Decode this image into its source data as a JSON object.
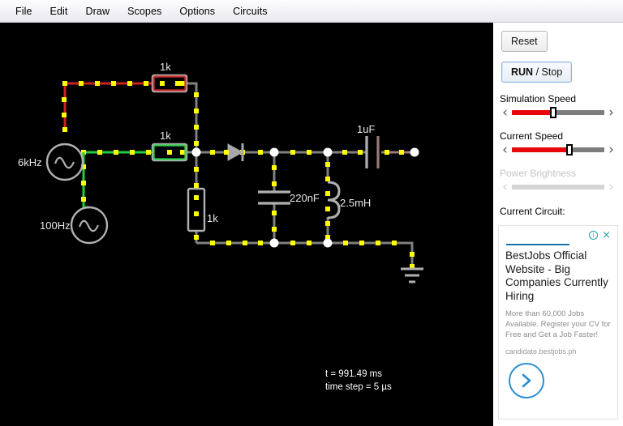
{
  "menubar": {
    "items": [
      {
        "label": "File"
      },
      {
        "label": "Edit"
      },
      {
        "label": "Draw"
      },
      {
        "label": "Scopes"
      },
      {
        "label": "Options"
      },
      {
        "label": "Circuits"
      }
    ]
  },
  "canvas": {
    "background_color": "#000000",
    "wire_color": "#808080",
    "charge_color": "#ffff00",
    "labels": {
      "source1": "6kHz",
      "source2": "100Hz",
      "r_top": "1k",
      "r_mid": "1k",
      "r_vert": "1k",
      "cap1": "220nF",
      "inductor": "2.5mH",
      "cap2": "1uF"
    },
    "status": {
      "time": "t = 991.49 ms",
      "timestep": "time step = 5 µs"
    },
    "voltage_colors": {
      "positive": "#cc2222",
      "negative": "#22cc44",
      "neutral": "#808080"
    }
  },
  "sidebar": {
    "reset_label": "Reset",
    "run_label": "RUN",
    "stop_label": " / Stop",
    "sliders": [
      {
        "label": "Simulation Speed",
        "value": 45,
        "enabled": true
      },
      {
        "label": "Current Speed",
        "value": 62,
        "enabled": true
      },
      {
        "label": "Power Brightness",
        "value": 0,
        "enabled": false
      }
    ],
    "current_circuit_label": "Current Circuit:",
    "left_arrow": "‹",
    "right_arrow": "›"
  },
  "ad": {
    "info_glyph": "i",
    "close_glyph": "×",
    "title": "BestJobs Official Website - Big Companies Currently Hiring",
    "body": "More than 60,000 Jobs Available. Register your CV for Free and Get a Job Faster!",
    "url": "candidate.bestjobs.ph",
    "accent_color": "#2b8fd1"
  }
}
